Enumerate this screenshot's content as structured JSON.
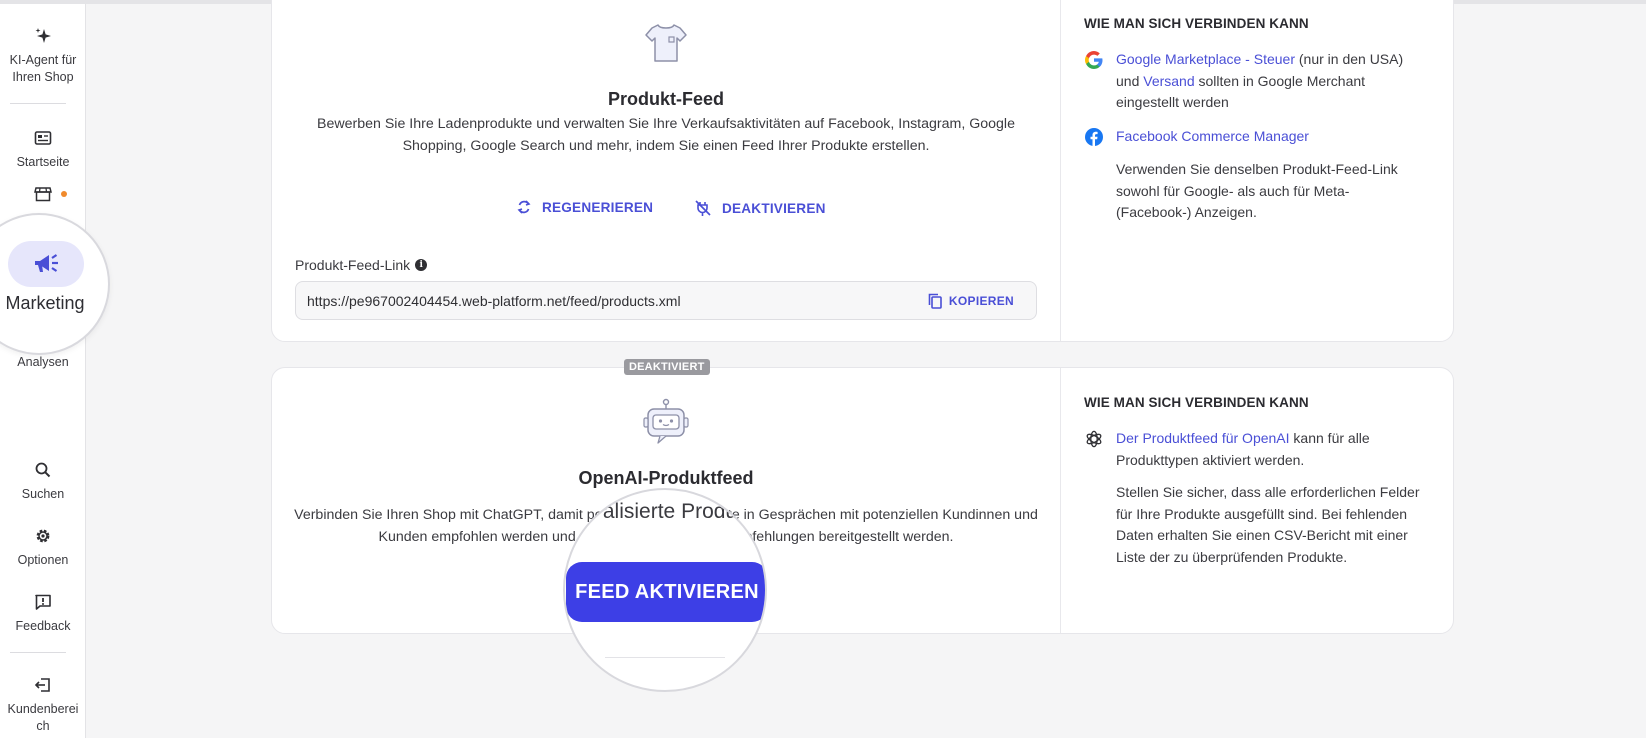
{
  "sidebar": {
    "items": [
      {
        "label": "KI-Agent für Ihren Shop",
        "icon": "sparkle-icon"
      },
      {
        "label": "Startseite",
        "icon": "dashboard-icon"
      },
      {
        "label": "",
        "icon": "store-icon"
      },
      {
        "label": "Marketing",
        "icon": "megaphone-icon"
      },
      {
        "label": "Analysen",
        "icon": "chart-icon"
      },
      {
        "label": "Suchen",
        "icon": "search-icon"
      },
      {
        "label": "Optionen",
        "icon": "gear-icon"
      },
      {
        "label": "Feedback",
        "icon": "feedback-icon"
      },
      {
        "label": "Kundenbereich",
        "icon": "logout-icon"
      }
    ]
  },
  "product_feed": {
    "title": "Produkt-Feed",
    "description": "Bewerben Sie Ihre Ladenprodukte und verwalten Sie Ihre Verkaufsaktivitäten auf Facebook, Instagram, Google Shopping, Google Search und mehr, indem Sie einen Feed Ihrer Produkte erstellen.",
    "regenerate_label": "REGENERIEREN",
    "deactivate_label": "DEAKTIVIEREN",
    "link_label": "Produkt-Feed-Link",
    "link_value": "https://pe967002404454.web-platform.net/feed/products.xml",
    "copy_label": "KOPIEREN",
    "connect_heading": "WIE MAN SICH VERBINDEN KANN",
    "google_link1": "Google Marketplace - Steuer",
    "google_text1": " (nur in den USA) und ",
    "google_link2": "Versand",
    "google_text2": " sollten in Google Merchant eingestellt werden",
    "facebook_link": "Facebook Commerce Manager",
    "note": "Verwenden Sie denselben Produkt-Feed-Link sowohl für Google- als auch für Meta- (Facebook-) Anzeigen."
  },
  "openai_feed": {
    "status_badge": "DEAKTIVIERT",
    "title": "OpenAI-Produktfeed",
    "description_line1": "Verbinden Sie Ihren Shop mit ChatGPT, damit personalisierte Produkte in Gesprächen mit potenziellen Kundinnen und",
    "description_line2": "Kunden empfohlen werden und personalisierte Produktempfehlungen bereitgestellt werden.",
    "lens_text": "alisierte Produ",
    "activate_label": "FEED AKTIVIEREN",
    "connect_heading": "WIE MAN SICH VERBINDEN KANN",
    "openai_link": "Der Produktfeed für OpenAI",
    "openai_text": " kann für alle Produkttypen aktiviert werden.",
    "note": "Stellen Sie sicher, dass alle erforderlichen Felder für Ihre Produkte ausgefüllt sind. Bei fehlenden Daten erhalten Sie einen CSV-Bericht mit einer Liste der zu überprüfenden Produkte."
  },
  "colors": {
    "accent": "#4a4fd6",
    "button": "#3d3fe6",
    "notification_dot": "#f08a2c",
    "badge": "#9a9a9f"
  }
}
